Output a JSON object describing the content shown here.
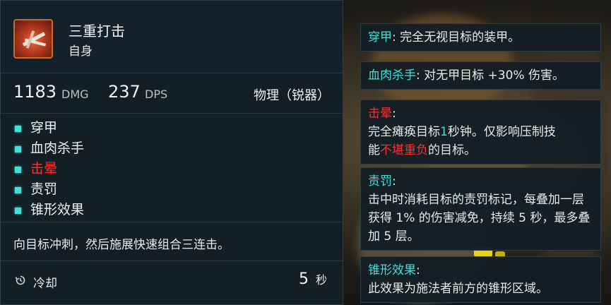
{
  "skill": {
    "name": "三重打击",
    "target": "自身",
    "damage": "1183",
    "damage_unit": "DMG",
    "dps": "237",
    "dps_unit": "DPS",
    "damage_type": "物理（锐器）",
    "tags": [
      {
        "label": "穿甲",
        "color": "#eef2f4"
      },
      {
        "label": "血肉杀手",
        "color": "#eef2f4"
      },
      {
        "label": "击晕",
        "color": "#ff3030"
      },
      {
        "label": "责罚",
        "color": "#eef2f4"
      },
      {
        "label": "锥形效果",
        "color": "#eef2f4"
      }
    ],
    "description": "向目标冲刺，然后施展快速组合三连击。",
    "cooldown_label": "冷却",
    "cooldown_value": "5",
    "cooldown_unit": "秒",
    "icon": "triple-strike-blades-icon"
  },
  "tooltips": [
    {
      "title": "穿甲",
      "sep": ":",
      "text": " 完全无视目标的装甲。"
    },
    {
      "title": "血肉杀手",
      "sep": ":",
      "text": " 对无甲目标 +30% 伤害。"
    },
    {
      "title": "击晕",
      "sep": ":",
      "line1_a": "完全瘫痪目标",
      "line1_num": "1",
      "line1_b": "秒钟。仅影响压制技",
      "line2_a": "能",
      "line2_red": "不堪重负",
      "line2_b": "的目标。"
    },
    {
      "title": "责罚",
      "sep": ":",
      "text": "击中时消耗目标的责罚标记，每叠加一层获得 1% 的伤害减免，持续 5 秒，最多叠加 5 层。"
    },
    {
      "title": "锥形效果",
      "sep": ":",
      "text": "此效果为施法者前方的锥形区域。"
    }
  ],
  "colors": {
    "accent_cyan": "#3fe0d8",
    "status_red": "#ff3030",
    "panel_bg": "#141e25"
  }
}
